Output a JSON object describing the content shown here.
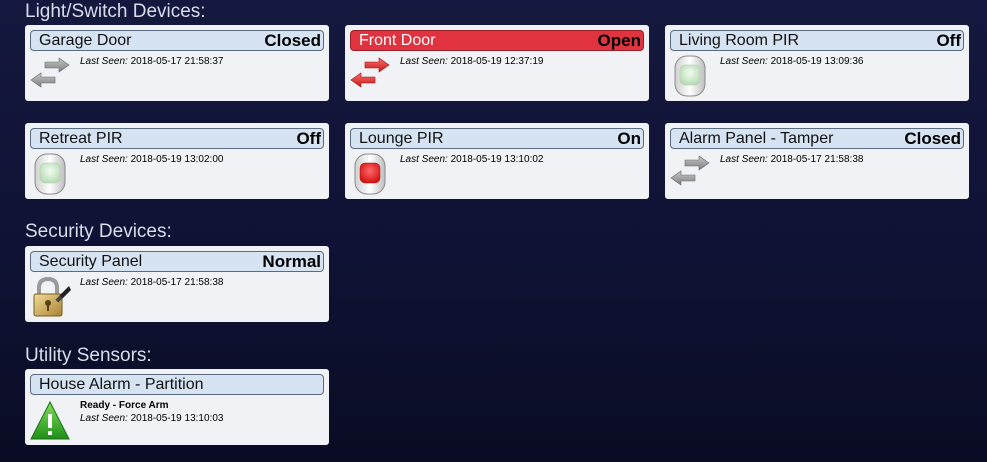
{
  "sections": {
    "light_switch": "Light/Switch Devices:",
    "security": "Security Devices:",
    "utility": "Utility Sensors:"
  },
  "last_seen_label": "Last Seen:",
  "devices": [
    {
      "name": "Garage Door",
      "state": "Closed",
      "last_seen": "2018-05-17 21:58:37",
      "icon": "gray-arrows-icon",
      "alert": false
    },
    {
      "name": "Front Door",
      "state": "Open",
      "last_seen": "2018-05-19 12:37:19",
      "icon": "red-arrows-icon",
      "alert": true
    },
    {
      "name": "Living Room PIR",
      "state": "Off",
      "last_seen": "2018-05-19 13:09:36",
      "icon": "pir-green-icon",
      "alert": false
    },
    {
      "name": "Retreat PIR",
      "state": "Off",
      "last_seen": "2018-05-19 13:02:00",
      "icon": "pir-green-icon",
      "alert": false
    },
    {
      "name": "Lounge PIR",
      "state": "On",
      "last_seen": "2018-05-19 13:10:02",
      "icon": "pir-red-icon",
      "alert": false
    },
    {
      "name": "Alarm Panel - Tamper",
      "state": "Closed",
      "last_seen": "2018-05-17 21:58:38",
      "icon": "gray-arrows-icon",
      "alert": false
    }
  ],
  "security_devices": [
    {
      "name": "Security Panel",
      "state": "Normal",
      "last_seen": "2018-05-17 21:58:38",
      "icon": "padlock-icon"
    }
  ],
  "utility_sensors": [
    {
      "name": "House Alarm - Partition",
      "status": "Ready - Force Arm",
      "last_seen": "2018-05-19 13:10:03",
      "icon": "warning-triangle-icon"
    }
  ],
  "colors": {
    "background": "#12153a",
    "card": "#f1f2f6",
    "header": "#d6e3f2",
    "alert_header": "#e1333f"
  }
}
